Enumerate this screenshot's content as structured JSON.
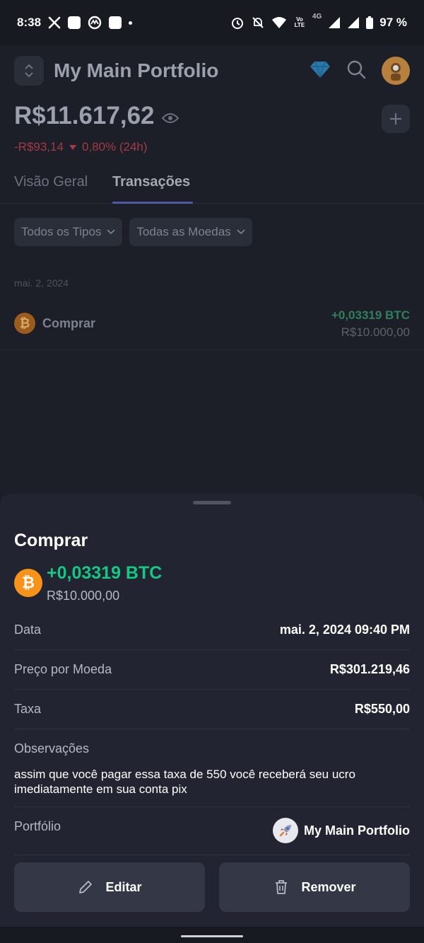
{
  "status_bar": {
    "time": "8:38",
    "network_lte": "Vo LTE",
    "network_gen": "4G",
    "battery": "97 %"
  },
  "header": {
    "portfolio_name": "My Main Portfolio",
    "balance": "R$11.617,62",
    "change_amount": "-R$93,14",
    "change_percent": "0,80% (24h)"
  },
  "tabs": [
    "Visão Geral",
    "Transações"
  ],
  "filters": [
    "Todos os Tipos",
    "Todas as Moedas"
  ],
  "transaction_list": {
    "date": "mai. 2, 2024",
    "type": "Comprar",
    "amount": "+0,03319 BTC",
    "fiat": "R$10.000,00"
  },
  "sheet": {
    "title": "Comprar",
    "coin_symbol": "₿",
    "amount": "+0,03319 BTC",
    "fiat": "R$10.000,00",
    "rows": [
      {
        "label": "Data",
        "value": "mai. 2, 2024 09:40 PM"
      },
      {
        "label": "Preço por Moeda",
        "value": "R$301.219,46"
      },
      {
        "label": "Taxa",
        "value": "R$550,00"
      }
    ],
    "notes_label": "Observações",
    "notes": "assim que você pagar essa taxa de 550 você receberá seu ucro imediatamente em sua conta pix",
    "portfolio_label": "Portfólio",
    "portfolio_value": "My Main Portfolio",
    "edit_label": "Editar",
    "remove_label": "Remover"
  },
  "colors": {
    "accent_green": "#16c784",
    "bitcoin_orange": "#f7931a",
    "negative_red": "#a33a45",
    "sheet_bg": "#222531"
  }
}
